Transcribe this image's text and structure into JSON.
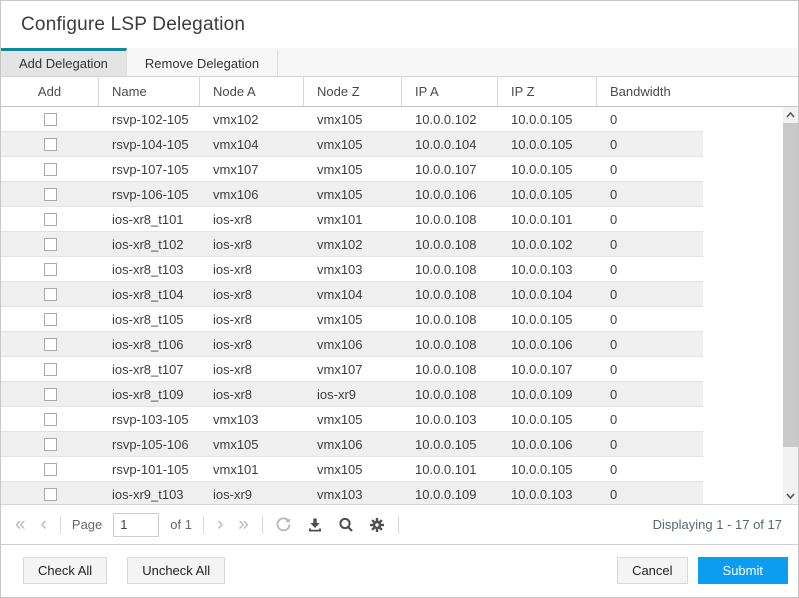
{
  "dialog": {
    "title": "Configure LSP Delegation"
  },
  "tabs": [
    {
      "label": "Add Delegation",
      "active": true
    },
    {
      "label": "Remove Delegation",
      "active": false
    }
  ],
  "table": {
    "columns": [
      "Add",
      "Name",
      "Node A",
      "Node Z",
      "IP A",
      "IP Z",
      "Bandwidth"
    ],
    "rows": [
      {
        "checked": false,
        "name": "rsvp-102-105",
        "node_a": "vmx102",
        "node_z": "vmx105",
        "ip_a": "10.0.0.102",
        "ip_z": "10.0.0.105",
        "bandwidth": "0"
      },
      {
        "checked": false,
        "name": "rsvp-104-105",
        "node_a": "vmx104",
        "node_z": "vmx105",
        "ip_a": "10.0.0.104",
        "ip_z": "10.0.0.105",
        "bandwidth": "0"
      },
      {
        "checked": false,
        "name": "rsvp-107-105",
        "node_a": "vmx107",
        "node_z": "vmx105",
        "ip_a": "10.0.0.107",
        "ip_z": "10.0.0.105",
        "bandwidth": "0"
      },
      {
        "checked": false,
        "name": "rsvp-106-105",
        "node_a": "vmx106",
        "node_z": "vmx105",
        "ip_a": "10.0.0.106",
        "ip_z": "10.0.0.105",
        "bandwidth": "0"
      },
      {
        "checked": false,
        "name": "ios-xr8_t101",
        "node_a": "ios-xr8",
        "node_z": "vmx101",
        "ip_a": "10.0.0.108",
        "ip_z": "10.0.0.101",
        "bandwidth": "0"
      },
      {
        "checked": false,
        "name": "ios-xr8_t102",
        "node_a": "ios-xr8",
        "node_z": "vmx102",
        "ip_a": "10.0.0.108",
        "ip_z": "10.0.0.102",
        "bandwidth": "0"
      },
      {
        "checked": false,
        "name": "ios-xr8_t103",
        "node_a": "ios-xr8",
        "node_z": "vmx103",
        "ip_a": "10.0.0.108",
        "ip_z": "10.0.0.103",
        "bandwidth": "0"
      },
      {
        "checked": false,
        "name": "ios-xr8_t104",
        "node_a": "ios-xr8",
        "node_z": "vmx104",
        "ip_a": "10.0.0.108",
        "ip_z": "10.0.0.104",
        "bandwidth": "0"
      },
      {
        "checked": false,
        "name": "ios-xr8_t105",
        "node_a": "ios-xr8",
        "node_z": "vmx105",
        "ip_a": "10.0.0.108",
        "ip_z": "10.0.0.105",
        "bandwidth": "0"
      },
      {
        "checked": false,
        "name": "ios-xr8_t106",
        "node_a": "ios-xr8",
        "node_z": "vmx106",
        "ip_a": "10.0.0.108",
        "ip_z": "10.0.0.106",
        "bandwidth": "0"
      },
      {
        "checked": false,
        "name": "ios-xr8_t107",
        "node_a": "ios-xr8",
        "node_z": "vmx107",
        "ip_a": "10.0.0.108",
        "ip_z": "10.0.0.107",
        "bandwidth": "0"
      },
      {
        "checked": false,
        "name": "ios-xr8_t109",
        "node_a": "ios-xr8",
        "node_z": "ios-xr9",
        "ip_a": "10.0.0.108",
        "ip_z": "10.0.0.109",
        "bandwidth": "0"
      },
      {
        "checked": false,
        "name": "rsvp-103-105",
        "node_a": "vmx103",
        "node_z": "vmx105",
        "ip_a": "10.0.0.103",
        "ip_z": "10.0.0.105",
        "bandwidth": "0"
      },
      {
        "checked": false,
        "name": "rsvp-105-106",
        "node_a": "vmx105",
        "node_z": "vmx106",
        "ip_a": "10.0.0.105",
        "ip_z": "10.0.0.106",
        "bandwidth": "0"
      },
      {
        "checked": false,
        "name": "rsvp-101-105",
        "node_a": "vmx101",
        "node_z": "vmx105",
        "ip_a": "10.0.0.101",
        "ip_z": "10.0.0.105",
        "bandwidth": "0"
      },
      {
        "checked": false,
        "name": "ios-xr9_t103",
        "node_a": "ios-xr9",
        "node_z": "vmx103",
        "ip_a": "10.0.0.109",
        "ip_z": "10.0.0.103",
        "bandwidth": "0"
      }
    ]
  },
  "pager": {
    "first_icon": "«",
    "prev_icon": "‹",
    "next_icon": "›",
    "last_icon": "»",
    "page_label": "Page",
    "page_value": "1",
    "of_label": "of 1",
    "status": "Displaying 1 - 17 of 17"
  },
  "footer": {
    "check_all": "Check All",
    "uncheck_all": "Uncheck All",
    "cancel": "Cancel",
    "submit": "Submit"
  },
  "colors": {
    "accent_teal": "#0d8c96",
    "submit_blue": "#0d9df0"
  }
}
